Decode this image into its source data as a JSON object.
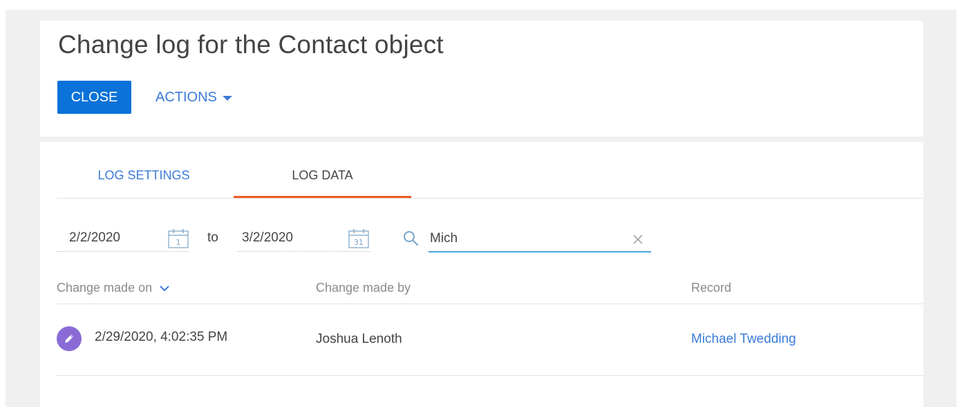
{
  "header": {
    "title": "Change log for the Contact object",
    "close_label": "CLOSE",
    "actions_label": "ACTIONS"
  },
  "tabs": [
    {
      "label": "LOG SETTINGS",
      "active": false
    },
    {
      "label": "LOG DATA",
      "active": true
    }
  ],
  "filters": {
    "date_from": "2/2/2020",
    "date_from_icon_day": "1",
    "to_label": "to",
    "date_to": "3/2/2020",
    "date_to_icon_day": "31",
    "search_value": "Mich"
  },
  "table": {
    "columns": [
      "Change made on",
      "Change made by",
      "Record"
    ],
    "rows": [
      {
        "icon": "pencil-icon",
        "date": "2/29/2020, 4:02:35 PM",
        "by": "Joshua Lenoth",
        "record": "Michael Twedding"
      }
    ]
  },
  "colors": {
    "primary": "#0a72d9",
    "link": "#3b7bd8",
    "active_tab_underline": "#f05a28",
    "search_underline": "#46a7df",
    "row_icon_bg": "#8a6bd6"
  }
}
